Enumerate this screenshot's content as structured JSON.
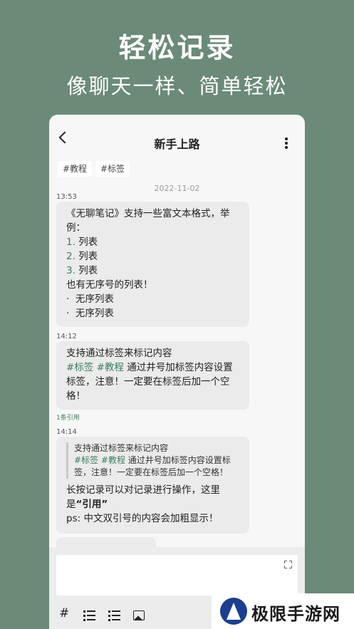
{
  "hero": {
    "title": "轻松记录",
    "subtitle": "像聊天一样、简单轻松"
  },
  "appbar": {
    "title": "新手上路",
    "back_icon": "chevron-left-icon",
    "more_icon": "more-vert-icon"
  },
  "tags": [
    "#教程",
    "#标签"
  ],
  "date": "2022-11-02",
  "notes": [
    {
      "time": "13:53",
      "line1": "《无聊笔记》支持一些富文本格式，举",
      "line2": "例：",
      "ordered": [
        {
          "num": "1.",
          "text": "列表"
        },
        {
          "num": "2.",
          "text": "列表"
        },
        {
          "num": "3.",
          "text": "列表"
        }
      ],
      "line3": "也有无序号的列表！",
      "unordered": [
        {
          "bullet": "·",
          "text": "无序列表"
        },
        {
          "bullet": "·",
          "text": "无序列表"
        }
      ]
    },
    {
      "time": "14:12",
      "line1": "支持通过标签来标记内容",
      "tag1": "#标签",
      "tag2": "#教程",
      "line2_rest": "通过井号加标签内容设置",
      "line3": "标签，注意！一定要在标签后加一个空",
      "line4": "格！",
      "reference": "1条引用"
    },
    {
      "time": "14:14",
      "quote_line1": "支持通过标签来标记内容",
      "quote_tag1": "#标签",
      "quote_tag2": "#教程",
      "quote_line2_rest": "通过井号加标签内容设置标",
      "quote_line3": "签，注意！一定要在标签后加一个空格！",
      "line1": "长按记录可以对记录进行操作，这里",
      "line2_prefix": "是",
      "line2_bold": "“引用”",
      "line3": "ps: 中文双引号的内容会加粗显示！"
    }
  ],
  "composer": {
    "expand_icon": "fullscreen-icon",
    "tools": {
      "hash": "#",
      "ordered_list_icon": "ordered-list-icon",
      "unordered_list_icon": "unordered-list-icon",
      "image_icon": "image-icon"
    }
  },
  "watermark": {
    "text": "极限手游网"
  }
}
